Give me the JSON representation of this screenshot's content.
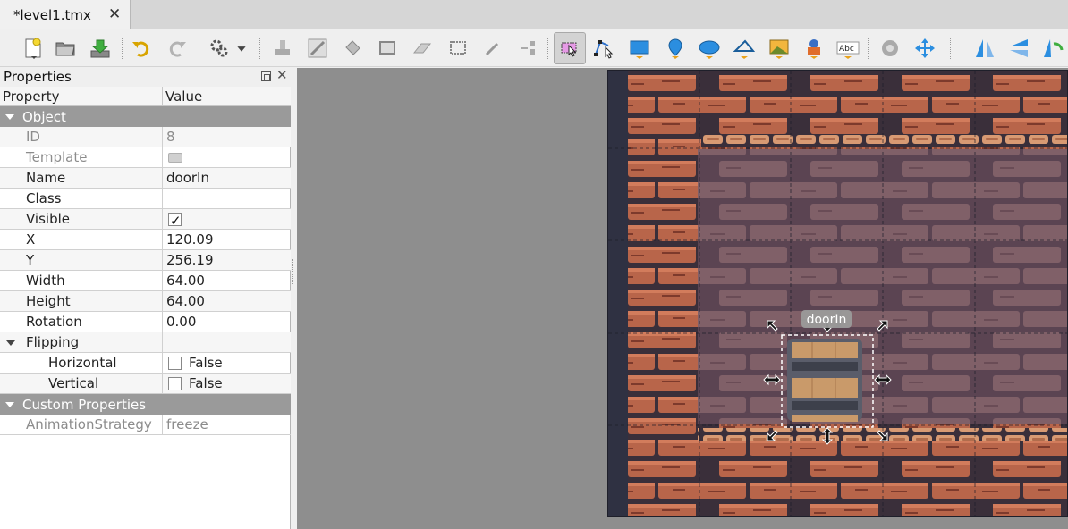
{
  "tab": {
    "title": "*level1.tmx",
    "close": "✕"
  },
  "toolbar": {
    "icons": [
      "new-map-icon",
      "open-icon",
      "save-icon",
      "undo-icon",
      "redo-icon",
      "commands-icon",
      "dropdown-arrow-icon",
      "stamp-brush-icon",
      "terrain-brush-icon",
      "bucket-fill-icon",
      "shape-fill-icon",
      "eraser-icon",
      "rectangular-select-icon",
      "magic-wand-icon",
      "select-same-tile-icon",
      "select-objects-icon",
      "edit-polygons-icon",
      "insert-rectangle-icon",
      "insert-point-icon",
      "insert-ellipse-icon",
      "insert-polygon-icon",
      "insert-tile-icon",
      "insert-template-icon",
      "insert-text-icon",
      "world-tool-icon",
      "move-icon",
      "flip-horizontal-icon",
      "flip-vertical-icon",
      "rotate-icon"
    ],
    "active_tool": "select-objects-icon"
  },
  "properties": {
    "title": "Properties",
    "columns": {
      "property": "Property",
      "value": "Value"
    },
    "groups": {
      "object": "Object",
      "custom": "Custom Properties"
    },
    "rows": {
      "id": {
        "key": "ID",
        "value": "8"
      },
      "template": {
        "key": "Template",
        "value": ""
      },
      "name": {
        "key": "Name",
        "value": "doorIn"
      },
      "class": {
        "key": "Class",
        "value": ""
      },
      "visible": {
        "key": "Visible",
        "checked": true
      },
      "x": {
        "key": "X",
        "value": "120.09"
      },
      "y": {
        "key": "Y",
        "value": "256.19"
      },
      "width": {
        "key": "Width",
        "value": "64.00"
      },
      "height": {
        "key": "Height",
        "value": "64.00"
      },
      "rotation": {
        "key": "Rotation",
        "value": "0.00"
      },
      "flipping": {
        "key": "Flipping"
      },
      "horizontal": {
        "key": "Horizontal",
        "value": "False"
      },
      "vertical": {
        "key": "Vertical",
        "value": "False"
      },
      "animation": {
        "key": "AnimationStrategy",
        "value": "freeze"
      }
    }
  },
  "canvas": {
    "selected_object_label": "doorIn",
    "colors": {
      "background": "#8e8e8e",
      "map_bg": "#2f3142",
      "brick": "#b8654a",
      "brick_dark": "#7d3a2c",
      "inner_wall": "#6d5058",
      "door_wood": "#c99a6a",
      "door_metal": "#5a5d6a"
    }
  }
}
